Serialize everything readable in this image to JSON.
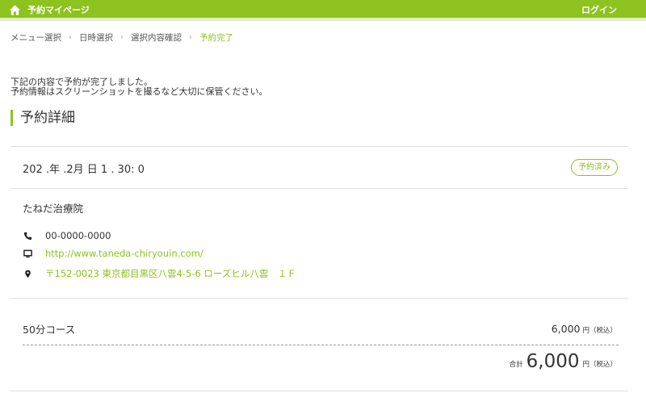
{
  "header": {
    "home_label": "予約マイページ",
    "login_label": "ログイン",
    "home_icon": "home-icon",
    "colors": {
      "brand": "#8dc21f",
      "brand_light": "#e2efc4"
    }
  },
  "breadcrumb": {
    "items": [
      "メニュー選択",
      "日時選択",
      "選択内容確認",
      "予約完了"
    ],
    "separator": "›"
  },
  "message": {
    "line1": "下記の内容で予約が完了しました。",
    "line2": "予約情報はスクリーンショットを撮るなど大切に保管ください。"
  },
  "section": {
    "title": "予約詳細"
  },
  "reservation": {
    "datetime": "202 .年 .2月 日 1 . 30: 0",
    "status_badge": "予約済み"
  },
  "clinic": {
    "name": "たねだ治療院",
    "phone": "00-0000-0000",
    "website": "http://www.taneda-chiryouin.com/",
    "address": "〒152-0023 東京都目黒区八雲4-5-6 ローズヒル八雲　１Ｆ",
    "icons": [
      "phone-icon",
      "monitor-icon",
      "map-pin-icon"
    ]
  },
  "order": {
    "course_name": "50分コース",
    "course_price": "6,000",
    "price_unit": "円（税込）",
    "total_label": "合計",
    "total_value": "6,000",
    "total_unit": "円（税込）"
  }
}
